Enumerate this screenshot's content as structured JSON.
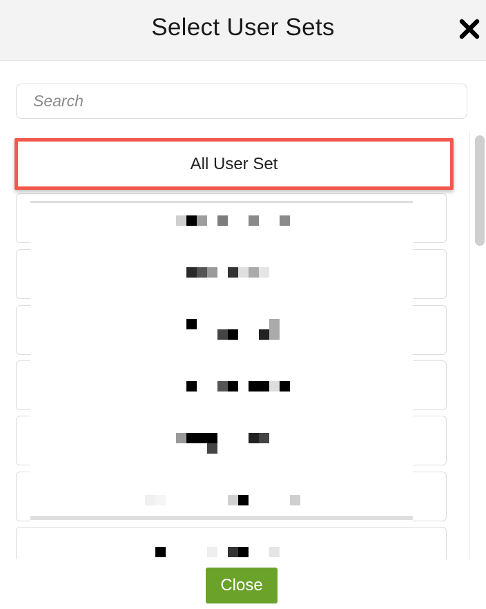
{
  "dialog": {
    "title": "Select User Sets"
  },
  "search": {
    "placeholder": "Search",
    "value": ""
  },
  "list": {
    "highlighted_item": "All User Set",
    "items": [
      "",
      "",
      "",
      "",
      "",
      "",
      ""
    ]
  },
  "footer": {
    "close_label": "Close"
  },
  "icons": {
    "close": "close-icon"
  },
  "colors": {
    "highlight_border": "#f2584e",
    "close_button": "#6aa22a",
    "header_bg": "#f3f3f3"
  }
}
